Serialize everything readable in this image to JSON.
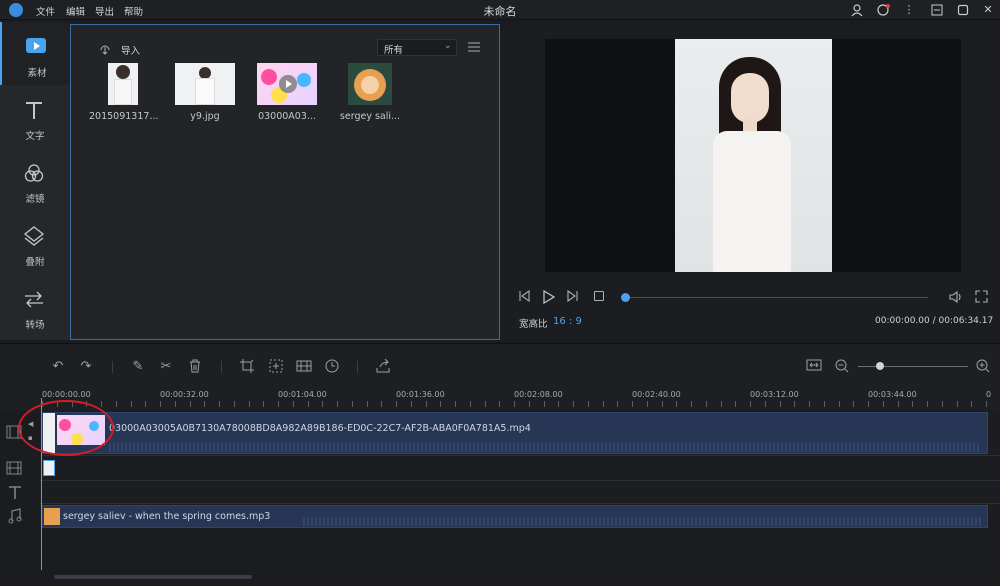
{
  "app": {
    "title": "未命名"
  },
  "menu": [
    "文件",
    "编辑",
    "导出",
    "帮助"
  ],
  "sidebar": [
    {
      "label": "素材",
      "icon": "media-icon"
    },
    {
      "label": "文字",
      "icon": "text-icon"
    },
    {
      "label": "滤镜",
      "icon": "filter-icon"
    },
    {
      "label": "叠附",
      "icon": "overlay-icon"
    },
    {
      "label": "转场",
      "icon": "transition-icon"
    }
  ],
  "media": {
    "import_label": "导入",
    "filter_select": "所有",
    "items": [
      {
        "name": "2015091317..."
      },
      {
        "name": "y9.jpg"
      },
      {
        "name": "03000A03..."
      },
      {
        "name": "sergey sali..."
      }
    ]
  },
  "preview": {
    "aspect_label": "宽高比",
    "aspect_value": "16 : 9",
    "time": "00:00:00.00 / 00:06:34.17",
    "progress": 0.0
  },
  "ruler": [
    "00:00:00.00",
    "00:00:32.00",
    "00:01:04.00",
    "00:01:36.00",
    "00:02:08.00",
    "00:02:40.00",
    "00:03:12.00",
    "00:03:44.00",
    "0"
  ],
  "tracks": {
    "video_clip": "03000A03005A0B7130A78008BD8A982A89B186-ED0C-22C7-AF2B-ABA0F0A781A5.mp4",
    "audio_clip": "sergey saliev - when the spring comes.mp3"
  },
  "colors": {
    "accent": "#4aa3f0",
    "clip": "#283655"
  }
}
